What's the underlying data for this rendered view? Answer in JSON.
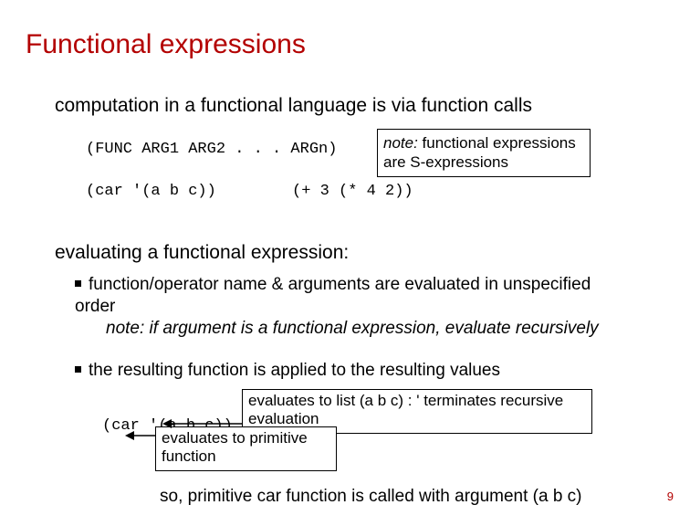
{
  "title": "Functional expressions",
  "intro": "computation in a functional language is via function calls",
  "code_syntax": "(FUNC ARG1 ARG2 . . . ARGn)",
  "note_box": {
    "note_label": "note:",
    "rest": " functional expressions are S-expressions"
  },
  "code_example1": "(car '(a b c))",
  "code_example2": "(+ 3 (* 4 2))",
  "eval_heading": "evaluating a functional expression:",
  "bullet1_line1": "function/operator name & arguments are evaluated in unspecified order",
  "bullet1_note": "note: if argument is a functional expression, evaluate recursively",
  "bullet2_line1": "the resulting function is applied to the resulting values",
  "code_example3": "(car '(a b c))",
  "anno1": "evaluates to list (a b c) : ' terminates recursive evaluation",
  "anno2": "evaluates to primitive function",
  "conclusion": "so, primitive car function is called with argument (a b c)",
  "page_number": "9"
}
